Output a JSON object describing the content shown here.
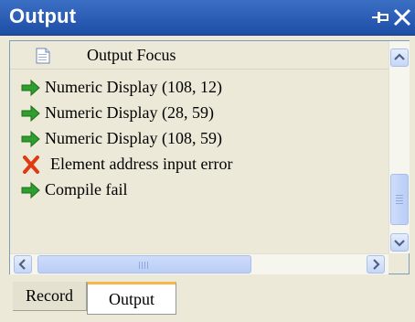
{
  "window": {
    "title": "Output",
    "pin_icon": "pin-icon",
    "close_icon": "close-icon"
  },
  "focus": {
    "label": "Output Focus",
    "icon": "document-icon"
  },
  "messages": [
    {
      "type": "info",
      "icon": "green-arrow-icon",
      "text": "Numeric Display (108, 12)"
    },
    {
      "type": "info",
      "icon": "green-arrow-icon",
      "text": "Numeric Display (28, 59)"
    },
    {
      "type": "info",
      "icon": "green-arrow-icon",
      "text": "Numeric Display (108, 59)"
    },
    {
      "type": "error",
      "icon": "red-x-icon",
      "text": "Element address input error"
    },
    {
      "type": "info",
      "icon": "green-arrow-icon",
      "text": "Compile fail"
    }
  ],
  "tabs": [
    {
      "label": "Record",
      "active": false
    },
    {
      "label": "Output",
      "active": true
    }
  ],
  "colors": {
    "titlebar": "#1d4ea6",
    "arrow": "#2e9e2e",
    "error": "#e03a10",
    "active_tab_accent": "#f3b74b"
  }
}
